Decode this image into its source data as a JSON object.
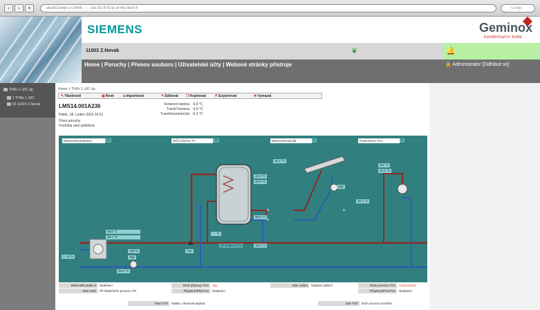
{
  "browser": {
    "url": "abcd01.bnlan.cz:14546 · ·····1bc·f2c·8·91·9c·ef·4ec·9bc0·4·",
    "search_placeholder": "Google"
  },
  "header": {
    "brand": "SIEMENS",
    "partner": "Geminox",
    "partner_tagline": "kondenzační kotle"
  },
  "userbar": {
    "name": "11003 Z.Novak"
  },
  "menu": {
    "items": [
      "Home",
      "Poruchy",
      "Přenos souboru",
      "Uživatelské účty",
      "Webové stránky přístroje"
    ],
    "separator": " | ",
    "user": "Administrator",
    "logout": "[Odhlásit se]"
  },
  "sidebar": {
    "items": [
      "THRs 1-10C dp",
      "1 THRs 1-10C",
      "03 11003 Z.Novak"
    ]
  },
  "breadcrumb": {
    "home": "Home",
    "sep": " > ",
    "current": "THRs 1-10C dp"
  },
  "toolbar": {
    "items": [
      "Vlastnosti",
      "Nové",
      "Importovat",
      "Editovat",
      "Kopírovat",
      "Exportovat",
      "Vymazat"
    ]
  },
  "device": {
    "title": "LMS14.001A236",
    "datetime": "Pátek, 18. Leden 2013 10:21",
    "status1": "0:bez poruchy",
    "status2": "0:údržba není potřebná",
    "temps": [
      {
        "label": "Venkovní teplota",
        "value": "-6.8 °C"
      },
      {
        "label": "TvenkTlumená",
        "value": "-3.6 °C"
      },
      {
        "label": "TvenkGeometrická",
        "value": "-6.2 °C"
      }
    ]
  },
  "scheme": {
    "labels": {
      "l1": "BlokSchémaOtepIyn",
      "l1v": "12",
      "l2": "Dílčí schéma TV",
      "l2v": "74",
      "l3": "BlokSchémaSolár",
      "l3v": "1",
      "l4": "Podschéma TO1",
      "l4v": "0"
    },
    "values": {
      "tank_top": "41.0 °C",
      "tank_top2": "40.0 °C",
      "tank_bot": "28.5 °C",
      "collector": "42.2 °C",
      "hc_flow1": "211 °C",
      "hc_flow2": "21.0 °C",
      "hc_ret": "36.1 °C",
      "boiler1": "36.6 °C",
      "boiler2": "36.1 °C",
      "boiler_pct": "1. 24 %",
      "pump_pct": "100 %",
      "tv_ret": "36.2 °C",
      "dt": "dT Solaru a TV",
      "dt_v": "16.3 °C",
      "flow_lbl": "Zap",
      "pump_zap": "Zap",
      "pump_vyp": "Vyp",
      "dash": "--- °C",
      "pump_ret": "30.2 °C",
      "r1": "R",
      "r2": "R",
      "b1": "B"
    }
  },
  "bottom": {
    "rows": [
      {
        "label": "BlokKotlKontakt H",
        "value": "Neaktivní"
      },
      {
        "label": "Stav kotle",
        "value": "Při částečném provozu TO"
      },
      {
        "label": "Druh přípravy TUV",
        "value": "Zap"
      },
      {
        "label": "PřepDruhPřípTUV",
        "value": "Neaktivní"
      },
      {
        "label": "Stav soláru",
        "value": "Nabíjení aktivní"
      },
      {
        "label": "Druh provozu TO1",
        "value": "Automatický"
      },
      {
        "label": "PřepDruhProvTO1",
        "value": "Neaktivní"
      },
      {
        "label": "Stav TUV",
        "value": "Nabito, situmová teplota"
      },
      {
        "label": "stav TO1",
        "value": "Druh provozu Komfort"
      }
    ]
  }
}
